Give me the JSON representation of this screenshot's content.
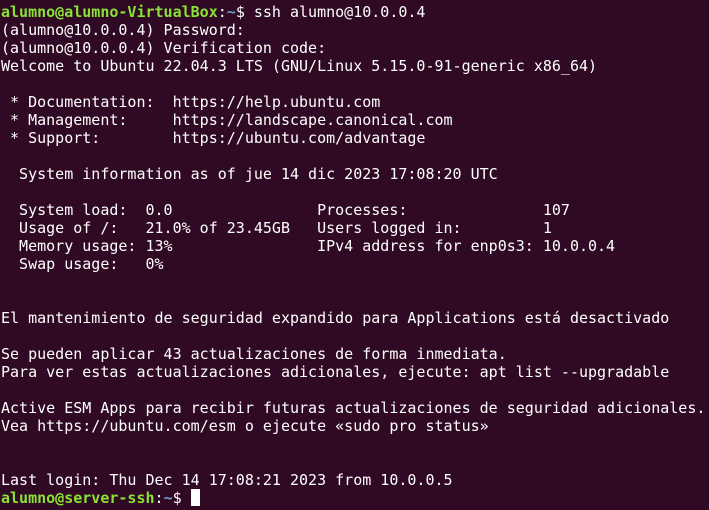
{
  "terminal": {
    "first_prompt": {
      "user_host": "alumno@alumno-VirtualBox",
      "sep": ":",
      "path": "~",
      "symbol": "$ ",
      "command": "ssh alumno@10.0.0.4"
    },
    "lines_a": [
      "(alumno@10.0.0.4) Password:",
      "(alumno@10.0.0.4) Verification code:",
      "Welcome to Ubuntu 22.04.3 LTS (GNU/Linux 5.15.0-91-generic x86_64)",
      "",
      " * Documentation:  https://help.ubuntu.com",
      " * Management:     https://landscape.canonical.com",
      " * Support:        https://ubuntu.com/advantage",
      "",
      "  System information as of jue 14 dic 2023 17:08:20 UTC",
      "",
      "  System load:  0.0                Processes:               107",
      "  Usage of /:   21.0% of 23.45GB   Users logged in:         1",
      "  Memory usage: 13%                IPv4 address for enp0s3: 10.0.0.4",
      "  Swap usage:   0%",
      "",
      "",
      "El mantenimiento de seguridad expandido para Applications está desactivado",
      "",
      "Se pueden aplicar 43 actualizaciones de forma inmediata.",
      "Para ver estas actualizaciones adicionales, ejecute: apt list --upgradable",
      "",
      "Active ESM Apps para recibir futuras actualizaciones de seguridad adicionales.",
      "Vea https://ubuntu.com/esm o ejecute «sudo pro status»",
      "",
      "",
      "Last login: Thu Dec 14 17:08:21 2023 from 10.0.0.5"
    ],
    "last_prompt": {
      "user_host": "alumno@server-ssh",
      "sep": ":",
      "path": "~",
      "symbol": "$ "
    },
    "colors": {
      "background": "#300a24",
      "text": "#ffffff",
      "prompt_user": "#8ae234",
      "prompt_path": "#729fcf"
    }
  }
}
